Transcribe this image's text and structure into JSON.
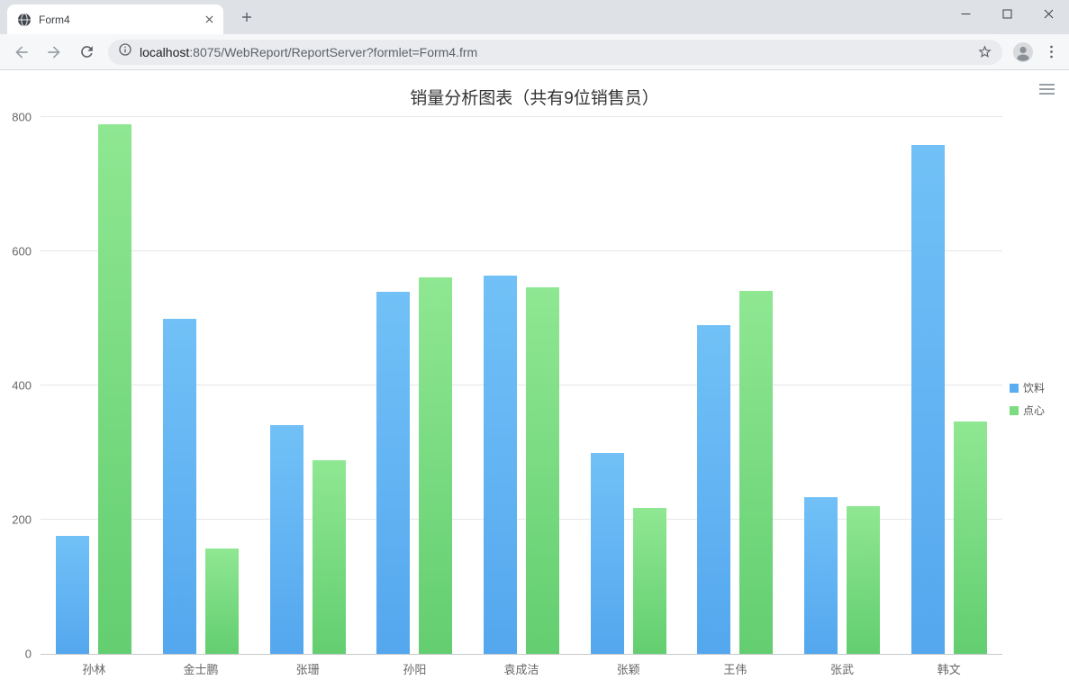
{
  "browser": {
    "tab_title": "Form4",
    "url": {
      "host": "localhost",
      "rest": ":8075/WebReport/ReportServer?formlet=Form4.frm"
    },
    "icons": {
      "back": "←",
      "forward": "→",
      "refresh": "⟳",
      "info": "ⓘ",
      "bookmark_star": "☆",
      "profile": "👤",
      "menu_dots": "⋮",
      "new_tab": "+",
      "tab_close": "×",
      "minimize": "—",
      "maximize": "□",
      "close": "×",
      "chart_menu": "≡"
    }
  },
  "chart_data": {
    "type": "bar",
    "title": "销量分析图表（共有9位销售员）",
    "categories": [
      "孙林",
      "金士鹏",
      "张珊",
      "孙阳",
      "袁成洁",
      "张颖",
      "王伟",
      "张武",
      "韩文"
    ],
    "series": [
      {
        "name": "饮料",
        "color": "#58AEF0",
        "gradient": [
          "#71C1F7",
          "#54A7EE"
        ],
        "values": [
          176,
          500,
          341,
          540,
          564,
          300,
          490,
          233,
          759
        ]
      },
      {
        "name": "点心",
        "color": "#7BDC82",
        "gradient": [
          "#8FE792",
          "#63CE70"
        ],
        "values": [
          789,
          157,
          289,
          561,
          546,
          218,
          541,
          220,
          347
        ]
      }
    ],
    "xlabel": "",
    "ylabel": "",
    "ylim": [
      0,
      800
    ],
    "yticks": [
      0,
      200,
      400,
      600,
      800
    ],
    "grid": true,
    "legend_position": "right"
  }
}
